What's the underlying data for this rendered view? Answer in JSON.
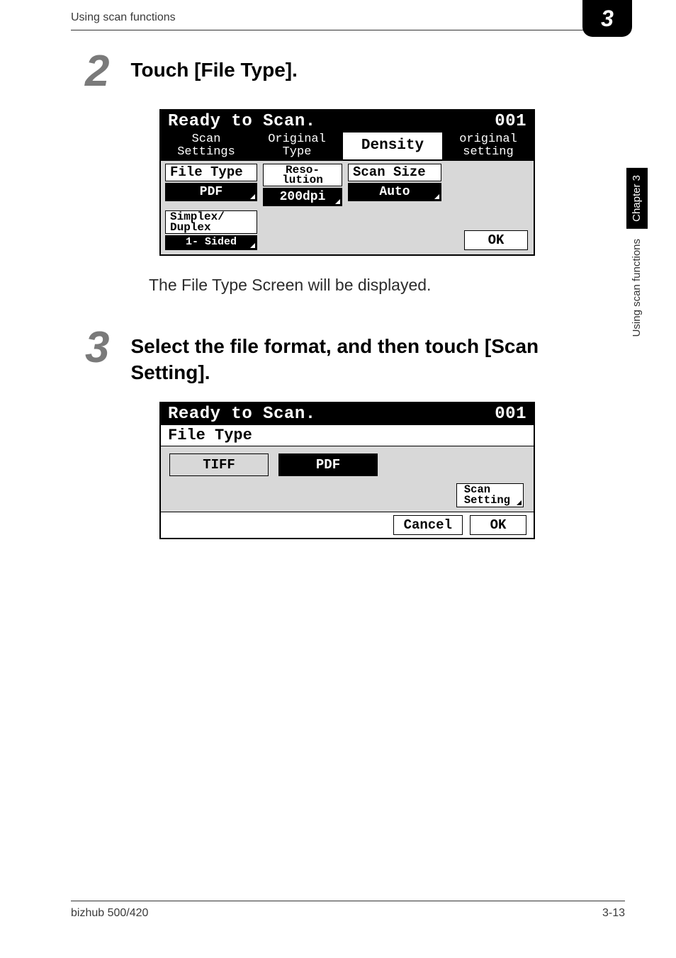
{
  "header": {
    "running": "Using scan functions",
    "chapter_badge": "3"
  },
  "sidetab": {
    "chapter": "Chapter 3",
    "text": "Using scan functions"
  },
  "steps": {
    "s2": {
      "num": "2",
      "title": "Touch [File Type].",
      "after": "The File Type Screen will be displayed."
    },
    "s3": {
      "num": "3",
      "title": "Select the file format, and then touch [Scan Setting]."
    }
  },
  "lcd1": {
    "title_left": "Ready to Scan.",
    "title_right": "001",
    "tabs": {
      "scan_settings": "Scan\nSettings",
      "original_type": "Original\nType",
      "density": "Density",
      "original_setting": "original\nsetting"
    },
    "cols": {
      "file_type_label": "File Type",
      "file_type_value": "PDF",
      "reso_label": "Reso-\nlution",
      "reso_value": "200dpi",
      "scan_size_label": "Scan Size",
      "scan_size_value": "Auto",
      "duplex_label": "Simplex/\nDuplex",
      "duplex_value": "1-\nSided"
    },
    "ok": "OK"
  },
  "lcd2": {
    "title_left": "Ready to Scan.",
    "title_right": "001",
    "subtitle": "File Type",
    "options": {
      "tiff": "TIFF",
      "pdf": "PDF"
    },
    "scan_setting": "Scan\nSetting",
    "cancel": "Cancel",
    "ok": "OK"
  },
  "footer": {
    "left": "bizhub 500/420",
    "right": "3-13"
  }
}
